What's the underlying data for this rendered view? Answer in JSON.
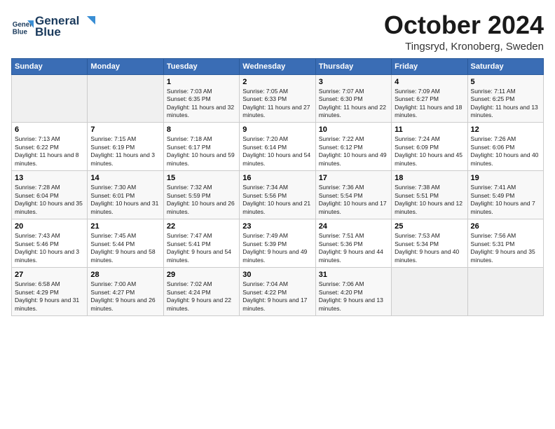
{
  "header": {
    "logo_line1": "General",
    "logo_line2": "Blue",
    "month": "October 2024",
    "location": "Tingsryd, Kronoberg, Sweden"
  },
  "weekdays": [
    "Sunday",
    "Monday",
    "Tuesday",
    "Wednesday",
    "Thursday",
    "Friday",
    "Saturday"
  ],
  "weeks": [
    [
      {
        "day": "",
        "empty": true
      },
      {
        "day": "",
        "empty": true
      },
      {
        "day": "1",
        "sunrise": "7:03 AM",
        "sunset": "6:35 PM",
        "daylight": "11 hours and 32 minutes."
      },
      {
        "day": "2",
        "sunrise": "7:05 AM",
        "sunset": "6:33 PM",
        "daylight": "11 hours and 27 minutes."
      },
      {
        "day": "3",
        "sunrise": "7:07 AM",
        "sunset": "6:30 PM",
        "daylight": "11 hours and 22 minutes."
      },
      {
        "day": "4",
        "sunrise": "7:09 AM",
        "sunset": "6:27 PM",
        "daylight": "11 hours and 18 minutes."
      },
      {
        "day": "5",
        "sunrise": "7:11 AM",
        "sunset": "6:25 PM",
        "daylight": "11 hours and 13 minutes."
      }
    ],
    [
      {
        "day": "6",
        "sunrise": "7:13 AM",
        "sunset": "6:22 PM",
        "daylight": "11 hours and 8 minutes."
      },
      {
        "day": "7",
        "sunrise": "7:15 AM",
        "sunset": "6:19 PM",
        "daylight": "11 hours and 3 minutes."
      },
      {
        "day": "8",
        "sunrise": "7:18 AM",
        "sunset": "6:17 PM",
        "daylight": "10 hours and 59 minutes."
      },
      {
        "day": "9",
        "sunrise": "7:20 AM",
        "sunset": "6:14 PM",
        "daylight": "10 hours and 54 minutes."
      },
      {
        "day": "10",
        "sunrise": "7:22 AM",
        "sunset": "6:12 PM",
        "daylight": "10 hours and 49 minutes."
      },
      {
        "day": "11",
        "sunrise": "7:24 AM",
        "sunset": "6:09 PM",
        "daylight": "10 hours and 45 minutes."
      },
      {
        "day": "12",
        "sunrise": "7:26 AM",
        "sunset": "6:06 PM",
        "daylight": "10 hours and 40 minutes."
      }
    ],
    [
      {
        "day": "13",
        "sunrise": "7:28 AM",
        "sunset": "6:04 PM",
        "daylight": "10 hours and 35 minutes."
      },
      {
        "day": "14",
        "sunrise": "7:30 AM",
        "sunset": "6:01 PM",
        "daylight": "10 hours and 31 minutes."
      },
      {
        "day": "15",
        "sunrise": "7:32 AM",
        "sunset": "5:59 PM",
        "daylight": "10 hours and 26 minutes."
      },
      {
        "day": "16",
        "sunrise": "7:34 AM",
        "sunset": "5:56 PM",
        "daylight": "10 hours and 21 minutes."
      },
      {
        "day": "17",
        "sunrise": "7:36 AM",
        "sunset": "5:54 PM",
        "daylight": "10 hours and 17 minutes."
      },
      {
        "day": "18",
        "sunrise": "7:38 AM",
        "sunset": "5:51 PM",
        "daylight": "10 hours and 12 minutes."
      },
      {
        "day": "19",
        "sunrise": "7:41 AM",
        "sunset": "5:49 PM",
        "daylight": "10 hours and 7 minutes."
      }
    ],
    [
      {
        "day": "20",
        "sunrise": "7:43 AM",
        "sunset": "5:46 PM",
        "daylight": "10 hours and 3 minutes."
      },
      {
        "day": "21",
        "sunrise": "7:45 AM",
        "sunset": "5:44 PM",
        "daylight": "9 hours and 58 minutes."
      },
      {
        "day": "22",
        "sunrise": "7:47 AM",
        "sunset": "5:41 PM",
        "daylight": "9 hours and 54 minutes."
      },
      {
        "day": "23",
        "sunrise": "7:49 AM",
        "sunset": "5:39 PM",
        "daylight": "9 hours and 49 minutes."
      },
      {
        "day": "24",
        "sunrise": "7:51 AM",
        "sunset": "5:36 PM",
        "daylight": "9 hours and 44 minutes."
      },
      {
        "day": "25",
        "sunrise": "7:53 AM",
        "sunset": "5:34 PM",
        "daylight": "9 hours and 40 minutes."
      },
      {
        "day": "26",
        "sunrise": "7:56 AM",
        "sunset": "5:31 PM",
        "daylight": "9 hours and 35 minutes."
      }
    ],
    [
      {
        "day": "27",
        "sunrise": "6:58 AM",
        "sunset": "4:29 PM",
        "daylight": "9 hours and 31 minutes."
      },
      {
        "day": "28",
        "sunrise": "7:00 AM",
        "sunset": "4:27 PM",
        "daylight": "9 hours and 26 minutes."
      },
      {
        "day": "29",
        "sunrise": "7:02 AM",
        "sunset": "4:24 PM",
        "daylight": "9 hours and 22 minutes."
      },
      {
        "day": "30",
        "sunrise": "7:04 AM",
        "sunset": "4:22 PM",
        "daylight": "9 hours and 17 minutes."
      },
      {
        "day": "31",
        "sunrise": "7:06 AM",
        "sunset": "4:20 PM",
        "daylight": "9 hours and 13 minutes."
      },
      {
        "day": "",
        "empty": true
      },
      {
        "day": "",
        "empty": true
      }
    ]
  ]
}
